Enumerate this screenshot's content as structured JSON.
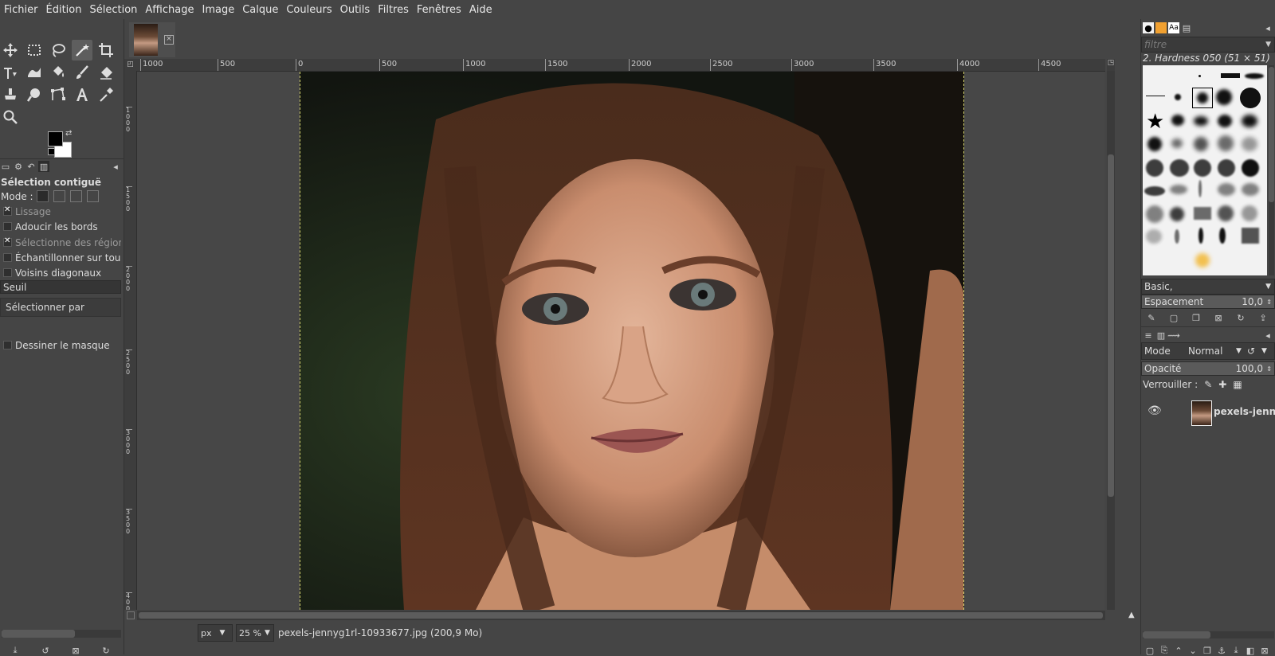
{
  "menu": [
    "Fichier",
    "Édition",
    "Sélection",
    "Affichage",
    "Image",
    "Calque",
    "Couleurs",
    "Outils",
    "Filtres",
    "Fenêtres",
    "Aide"
  ],
  "tool_options": {
    "title": "Sélection contiguë",
    "mode_label": "Mode :",
    "lissage": "Lissage",
    "adoucir": "Adoucir les bords",
    "selectionne_regions": "Sélectionne des régions",
    "echantillonner": "Échantillonner sur tous",
    "voisins": "Voisins diagonaux",
    "seuil": "Seuil",
    "selectionner_par": "Sélectionner par",
    "dessiner_masque": "Dessiner le masque"
  },
  "ruler": {
    "h_ticks": [
      "1000",
      "500",
      "0",
      "500",
      "1000",
      "1500",
      "2000",
      "2500",
      "3000",
      "3500",
      "4000",
      "4500"
    ],
    "v_ticks": [
      "1000",
      "1500",
      "2000",
      "2500",
      "3000",
      "3500",
      "4000"
    ]
  },
  "status": {
    "unit": "px",
    "zoom": "25 %",
    "filename": "pexels-jennyg1rl-10933677.jpg (200,9 Mo)"
  },
  "brushes": {
    "filter_placeholder": "filtre",
    "selected_brush": "2. Hardness 050 (51 × 51)",
    "preset": "Basic,",
    "spacing_label": "Espacement",
    "spacing_value": "10,0"
  },
  "layers": {
    "mode_label": "Mode",
    "mode_value": "Normal",
    "opacity_label": "Opacité",
    "opacity_value": "100,0",
    "lock_label": "Verrouiller :",
    "layer_name": "pexels-jenn"
  },
  "colors": {
    "foreground": "#000000",
    "background": "#ffffff",
    "ui_bg": "#454545",
    "selection_outline": "#cfcf6a"
  }
}
